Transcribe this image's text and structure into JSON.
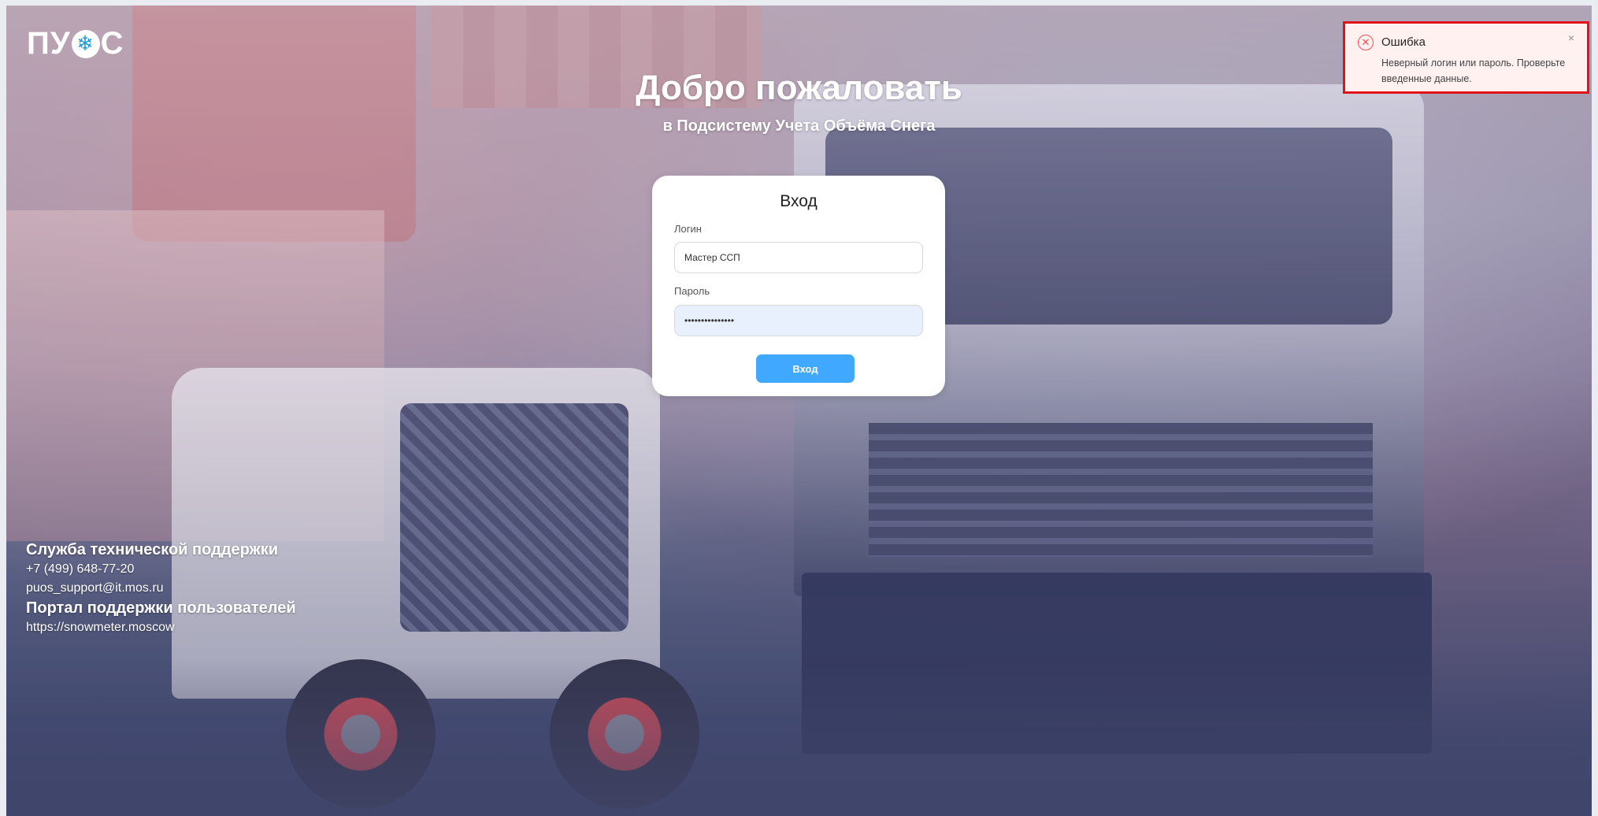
{
  "logo": {
    "text_left": "ПУ",
    "text_right": "С",
    "icon": "snowflake-icon"
  },
  "welcome": {
    "title": "Добро пожаловать",
    "subtitle": "в Подсистему Учета Объёма Снега"
  },
  "login_form": {
    "title": "Вход",
    "login_label": "Логин",
    "login_value": "Мастер ССП",
    "password_label": "Пароль",
    "password_value": "•••••••••••••••",
    "submit_label": "Вход"
  },
  "notification": {
    "type": "error",
    "icon": "error-circle-icon",
    "title": "Ошибка",
    "message": "Неверный логин или пароль. Проверьте введенные данные.",
    "close": "×"
  },
  "support": {
    "heading": "Служба технической поддержки",
    "phone": "+7 (499) 648-77-20",
    "email": "puos_support@it.mos.ru",
    "portal_heading": "Портал поддержки пользователей",
    "portal_url": "https://snowmeter.moscow"
  },
  "colors": {
    "primary": "#40a9ff",
    "error": "#ff4d4f",
    "error_bg": "#fff1f0",
    "highlight_border": "#e0131b"
  }
}
